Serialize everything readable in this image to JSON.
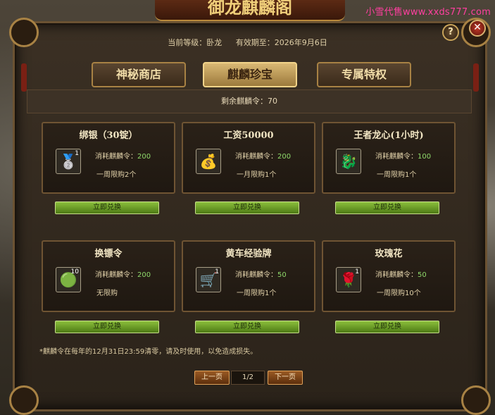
{
  "watermark": "小雪代售www.xxds777.com",
  "window_title": "御龙麒麟阁",
  "header": {
    "level_label": "当前等级：卧龙",
    "expiry_label": "有效期至：2026年9月6日"
  },
  "tabs": [
    {
      "label": "神秘商店",
      "active": false
    },
    {
      "label": "麒麟珍宝",
      "active": true
    },
    {
      "label": "专属特权",
      "active": false
    }
  ],
  "remaining": "剩余麒麟令：70",
  "cost_prefix": "消耗麒麟令：",
  "exchange_label": "立即兑换",
  "items": [
    {
      "name": "绑银（30锭）",
      "icon": "silver-ingot-icon",
      "glyph": "🥈",
      "qty": "1",
      "cost": "200",
      "limit": "一周限购2个"
    },
    {
      "name": "工资50000",
      "icon": "gold-coins-icon",
      "glyph": "💰",
      "qty": "",
      "cost": "200",
      "limit": "一月限购1个"
    },
    {
      "name": "王者龙心(1小时)",
      "icon": "dragon-heart-icon",
      "glyph": "🐉",
      "qty": "",
      "cost": "100",
      "limit": "一周限购1个"
    },
    {
      "name": "换镖令",
      "icon": "escort-token-icon",
      "glyph": "🟢",
      "qty": "10",
      "cost": "200",
      "limit": "无限购"
    },
    {
      "name": "黄车经验牌",
      "icon": "yellow-cart-exp-icon",
      "glyph": "🛒",
      "qty": "1",
      "cost": "50",
      "limit": "一周限购1个"
    },
    {
      "name": "玫瑰花",
      "icon": "rose-icon",
      "glyph": "🌹",
      "qty": "1",
      "cost": "50",
      "limit": "一周限购10个"
    }
  ],
  "notice": "*麒麟令在每年的12月31日23:59清零，请及时使用，以免造成损失。",
  "pager": {
    "prev": "上一页",
    "page": "1/2",
    "next": "下一页"
  },
  "buttons": {
    "help": "?",
    "close": "✕"
  }
}
